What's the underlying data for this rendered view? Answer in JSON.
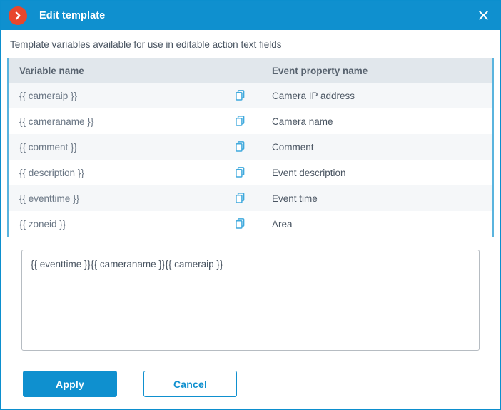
{
  "window": {
    "title": "Edit template",
    "logo_icon": "chevron-right-circle-icon",
    "close_icon": "close-icon"
  },
  "intro": {
    "text": "Template variables available for use in editable action text fields"
  },
  "table": {
    "columns": [
      "Variable name",
      "Event property name"
    ],
    "copy_icon": "copy-icon",
    "rows": [
      {
        "variable": "{{ cameraip }}",
        "property": "Camera IP address"
      },
      {
        "variable": "{{ cameraname }}",
        "property": "Camera name"
      },
      {
        "variable": "{{ comment }}",
        "property": "Comment"
      },
      {
        "variable": "{{ description }}",
        "property": "Event description"
      },
      {
        "variable": "{{ eventtime }}",
        "property": "Event time"
      },
      {
        "variable": "{{ zoneid }}",
        "property": "Area"
      }
    ]
  },
  "editor": {
    "value": "{{ eventtime }}{{ cameraname }}{{ cameraip }}",
    "placeholder": ""
  },
  "footer": {
    "apply_label": "Apply",
    "cancel_label": "Cancel"
  },
  "colors": {
    "header_blue": "#0f90cf",
    "logo_orange": "#e8472c",
    "table_header_bg": "#e1e7ec",
    "row_alt_bg": "#f5f7f9",
    "copy_icon_blue": "#3fa9dd",
    "text_dark": "#4a5562",
    "text_muted": "#6b7785"
  }
}
